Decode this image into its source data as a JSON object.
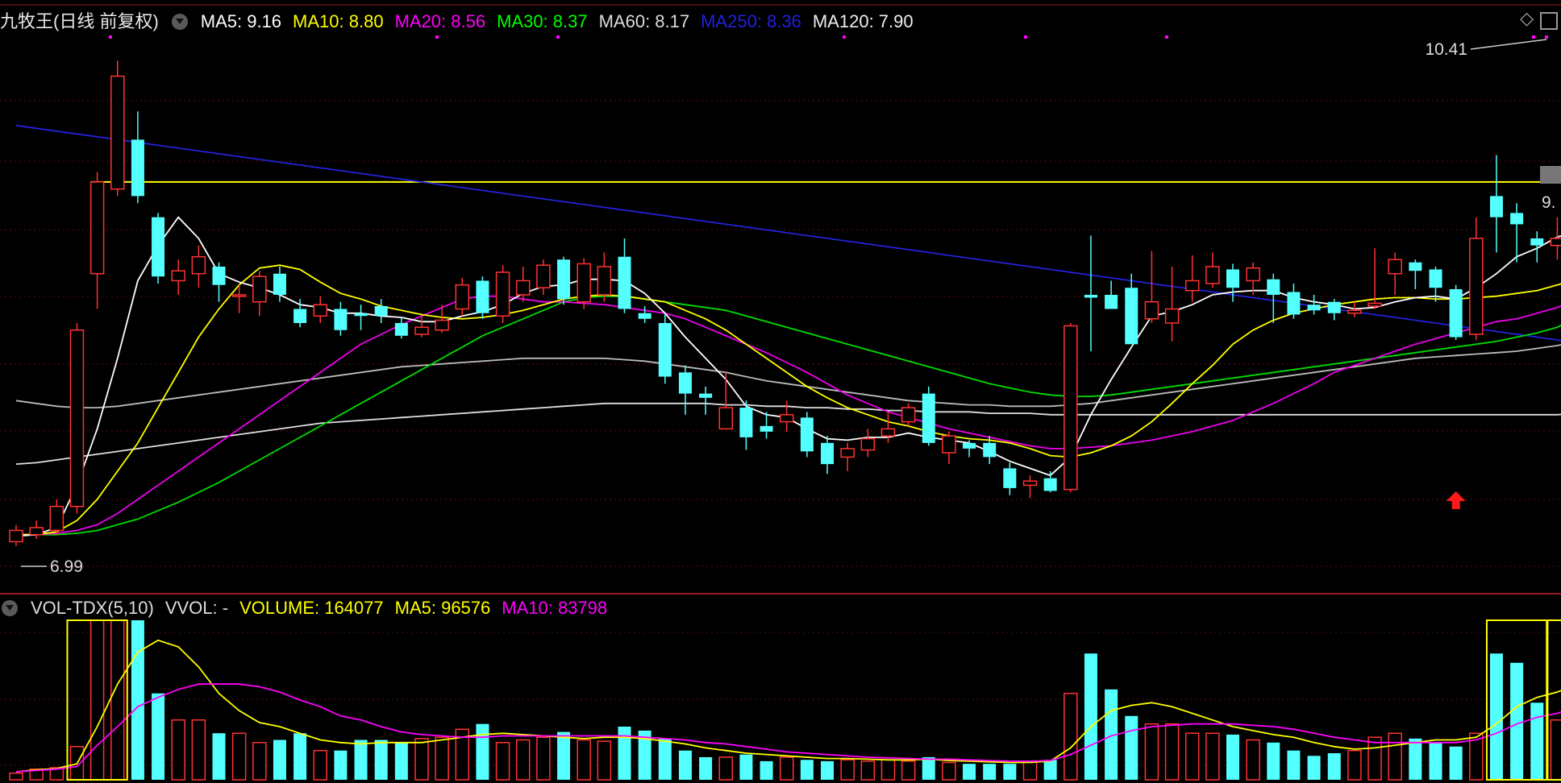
{
  "stock": {
    "name": "九牧王(日线 前复权)"
  },
  "ma_legend": [
    {
      "label": "MA5: 9.16",
      "color": "#ffffff"
    },
    {
      "label": "MA10: 8.80",
      "color": "#ffff00"
    },
    {
      "label": "MA20: 8.56",
      "color": "#ff00ff"
    },
    {
      "label": "MA30: 8.37",
      "color": "#00ff00"
    },
    {
      "label": "MA60: 8.17",
      "color": "#dddddd"
    },
    {
      "label": "MA250: 8.36",
      "color": "#2020e0"
    },
    {
      "label": "MA120: 7.90",
      "color": "#eeeeee"
    }
  ],
  "vol_legend": {
    "name": "VOL-TDX(5,10)",
    "vvol": "VVOL: -",
    "volume": "VOLUME: 164077",
    "ma5": "MA5: 96576",
    "ma10": "MA10: 83798"
  },
  "annotations": {
    "high": "10.41",
    "low": "6.99",
    "current_partial": "9."
  },
  "icons": {
    "diamond": "◇"
  },
  "colors": {
    "up": "#ff3232",
    "down": "#54ffff",
    "bg": "#000000",
    "grid": "#5a1010"
  },
  "chart_data": {
    "type": "candlestick",
    "ylim": [
      6.7,
      10.6
    ],
    "candles": [
      [
        7.0,
        7.08,
        7.12,
        6.97
      ],
      [
        7.05,
        7.1,
        7.15,
        7.02
      ],
      [
        7.08,
        7.25,
        7.3,
        7.05
      ],
      [
        7.25,
        8.5,
        8.55,
        7.2
      ],
      [
        8.9,
        9.55,
        9.62,
        8.65
      ],
      [
        9.5,
        10.3,
        10.41,
        9.45
      ],
      [
        9.85,
        9.45,
        10.05,
        9.4
      ],
      [
        9.3,
        8.88,
        9.33,
        8.83
      ],
      [
        8.85,
        8.92,
        9.0,
        8.75
      ],
      [
        8.9,
        9.02,
        9.1,
        8.8
      ],
      [
        8.95,
        8.82,
        8.98,
        8.7
      ],
      [
        8.74,
        8.75,
        8.82,
        8.62
      ],
      [
        8.7,
        8.88,
        8.92,
        8.6
      ],
      [
        8.9,
        8.75,
        8.95,
        8.7
      ],
      [
        8.65,
        8.55,
        8.72,
        8.52
      ],
      [
        8.6,
        8.68,
        8.74,
        8.55
      ],
      [
        8.65,
        8.5,
        8.7,
        8.46
      ],
      [
        8.62,
        8.6,
        8.68,
        8.5
      ],
      [
        8.67,
        8.6,
        8.72,
        8.55
      ],
      [
        8.55,
        8.46,
        8.59,
        8.44
      ],
      [
        8.47,
        8.52,
        8.6,
        8.45
      ],
      [
        8.5,
        8.57,
        8.68,
        8.48
      ],
      [
        8.65,
        8.82,
        8.87,
        8.6
      ],
      [
        8.85,
        8.62,
        8.88,
        8.58
      ],
      [
        8.6,
        8.91,
        8.96,
        8.55
      ],
      [
        8.75,
        8.85,
        8.95,
        8.7
      ],
      [
        8.8,
        8.96,
        9.0,
        8.75
      ],
      [
        9.0,
        8.72,
        9.02,
        8.68
      ],
      [
        8.7,
        8.97,
        9.01,
        8.65
      ],
      [
        8.75,
        8.95,
        9.05,
        8.7
      ],
      [
        9.02,
        8.65,
        9.15,
        8.62
      ],
      [
        8.62,
        8.58,
        8.67,
        8.55
      ],
      [
        8.55,
        8.17,
        8.62,
        8.12
      ],
      [
        8.2,
        8.05,
        8.25,
        7.9
      ],
      [
        8.05,
        8.02,
        8.1,
        7.9
      ],
      [
        7.8,
        7.95,
        8.2,
        7.95
      ],
      [
        7.95,
        7.74,
        8.0,
        7.65
      ],
      [
        7.82,
        7.78,
        7.92,
        7.73
      ],
      [
        7.85,
        7.9,
        8.0,
        7.78
      ],
      [
        7.88,
        7.64,
        7.92,
        7.6
      ],
      [
        7.7,
        7.55,
        7.75,
        7.48
      ],
      [
        7.6,
        7.66,
        7.7,
        7.5
      ],
      [
        7.65,
        7.73,
        7.8,
        7.6
      ],
      [
        7.75,
        7.8,
        7.92,
        7.7
      ],
      [
        7.85,
        7.95,
        7.98,
        7.82
      ],
      [
        8.05,
        7.7,
        8.1,
        7.68
      ],
      [
        7.63,
        7.75,
        7.78,
        7.55
      ],
      [
        7.7,
        7.66,
        7.72,
        7.6
      ],
      [
        7.7,
        7.6,
        7.75,
        7.55
      ],
      [
        7.52,
        7.38,
        7.56,
        7.33
      ],
      [
        7.4,
        7.43,
        7.47,
        7.31
      ],
      [
        7.45,
        7.36,
        7.5,
        7.35
      ],
      [
        7.37,
        8.53,
        8.55,
        7.35
      ],
      [
        8.75,
        8.73,
        9.17,
        8.35
      ],
      [
        8.75,
        8.65,
        8.85,
        8.7
      ],
      [
        8.8,
        8.4,
        8.9,
        8.4
      ],
      [
        8.58,
        8.7,
        9.06,
        8.55
      ],
      [
        8.55,
        8.65,
        8.95,
        8.42
      ],
      [
        8.78,
        8.85,
        9.03,
        8.7
      ],
      [
        8.83,
        8.95,
        9.05,
        8.8
      ],
      [
        8.93,
        8.8,
        8.97,
        8.7
      ],
      [
        8.85,
        8.94,
        8.98,
        8.75
      ],
      [
        8.86,
        8.75,
        8.9,
        8.55
      ],
      [
        8.77,
        8.61,
        8.83,
        8.58
      ],
      [
        8.68,
        8.64,
        8.75,
        8.61
      ],
      [
        8.7,
        8.62,
        8.72,
        8.57
      ],
      [
        8.62,
        8.64,
        8.7,
        8.59
      ],
      [
        8.67,
        8.69,
        9.08,
        8.65
      ],
      [
        8.9,
        9.0,
        9.05,
        8.75
      ],
      [
        8.98,
        8.92,
        9.0,
        8.79
      ],
      [
        8.93,
        8.8,
        8.95,
        8.7
      ],
      [
        8.79,
        8.45,
        8.82,
        8.43
      ],
      [
        8.47,
        9.15,
        9.3,
        8.43
      ],
      [
        9.45,
        9.3,
        9.74,
        9.05
      ],
      [
        9.33,
        9.25,
        9.4,
        8.98
      ],
      [
        9.15,
        9.1,
        9.2,
        8.98
      ],
      [
        9.1,
        9.15,
        9.3,
        9.0
      ],
      [
        9.2,
        9.45,
        9.78,
        9.18
      ],
      [
        9.45,
        10.1,
        10.41,
        9.4
      ]
    ],
    "volume_ylim": [
      0,
      120000
    ],
    "volume": [
      5000,
      8000,
      9000,
      25000,
      120000,
      165000,
      120000,
      65000,
      45000,
      45000,
      35000,
      35000,
      28000,
      30000,
      35000,
      22000,
      22000,
      30000,
      30000,
      28000,
      31000,
      32000,
      38000,
      42000,
      28000,
      30000,
      32000,
      36000,
      30000,
      29000,
      40000,
      37000,
      31000,
      22000,
      17000,
      17000,
      19000,
      14000,
      17000,
      15000,
      14000,
      15000,
      14000,
      15000,
      14000,
      17000,
      13000,
      12000,
      12000,
      12000,
      14000,
      15000,
      65000,
      95000,
      68000,
      48000,
      42000,
      42000,
      35000,
      35000,
      34000,
      30000,
      28000,
      22000,
      18000,
      20000,
      22000,
      32000,
      35000,
      31000,
      28000,
      25000,
      35000,
      95000,
      88000,
      58000,
      45000,
      42000,
      164077
    ],
    "vol_ma5": [
      6000,
      7500,
      8500,
      12000,
      40000,
      72000,
      96000,
      105000,
      100000,
      85000,
      65000,
      52000,
      43000,
      40000,
      35000,
      30000,
      28000,
      27000,
      28000,
      28000,
      28000,
      30000,
      32000,
      34000,
      35000,
      34000,
      33000,
      32000,
      31000,
      32000,
      32000,
      31000,
      29000,
      27000,
      24000,
      22000,
      20000,
      19000,
      18000,
      17000,
      16000,
      16000,
      15500,
      15000,
      15000,
      15500,
      14500,
      14000,
      13500,
      13000,
      13000,
      14000,
      24000,
      40000,
      52000,
      56000,
      58000,
      55000,
      50000,
      45000,
      40000,
      37000,
      34000,
      32000,
      28000,
      25000,
      23000,
      24000,
      26000,
      28000,
      30000,
      30000,
      32000,
      42000,
      55000,
      62000,
      66000,
      72000,
      96576
    ],
    "vol_ma10": [
      6000,
      7000,
      8000,
      10000,
      26000,
      40000,
      55000,
      62000,
      68000,
      72000,
      72000,
      72000,
      70000,
      66000,
      60000,
      55000,
      48000,
      45000,
      40000,
      36000,
      34000,
      33000,
      32000,
      32000,
      33000,
      33000,
      33000,
      33000,
      33000,
      33000,
      33000,
      32000,
      31000,
      30000,
      28000,
      27000,
      25000,
      23000,
      21000,
      20000,
      19000,
      18000,
      17000,
      16500,
      16000,
      15500,
      15500,
      15000,
      14500,
      14000,
      14000,
      14500,
      19000,
      26000,
      33000,
      37000,
      40000,
      41000,
      42000,
      42000,
      42000,
      41000,
      40000,
      38000,
      35000,
      32000,
      30000,
      28000,
      28000,
      28000,
      28000,
      28000,
      30000,
      35000,
      42000,
      47000,
      50000,
      55000,
      83798
    ],
    "ma5": [
      7.04,
      7.05,
      7.1,
      7.4,
      7.8,
      8.3,
      8.85,
      9.1,
      9.3,
      9.15,
      8.9,
      8.84,
      8.8,
      8.75,
      8.68,
      8.66,
      8.62,
      8.62,
      8.6,
      8.59,
      8.56,
      8.56,
      8.6,
      8.63,
      8.68,
      8.76,
      8.81,
      8.82,
      8.86,
      8.86,
      8.85,
      8.76,
      8.62,
      8.45,
      8.3,
      8.15,
      7.96,
      7.9,
      7.88,
      7.8,
      7.73,
      7.72,
      7.74,
      7.74,
      7.77,
      7.74,
      7.72,
      7.7,
      7.64,
      7.57,
      7.52,
      7.47,
      7.6,
      7.9,
      8.15,
      8.38,
      8.6,
      8.63,
      8.68,
      8.75,
      8.77,
      8.78,
      8.78,
      8.73,
      8.7,
      8.68,
      8.65,
      8.66,
      8.7,
      8.73,
      8.74,
      8.72,
      8.8,
      8.9,
      9.02,
      9.08,
      9.16,
      9.2,
      9.16
    ],
    "ma10": [
      7.05,
      7.05,
      7.07,
      7.15,
      7.3,
      7.5,
      7.7,
      7.95,
      8.2,
      8.45,
      8.65,
      8.82,
      8.94,
      8.96,
      8.93,
      8.84,
      8.76,
      8.72,
      8.67,
      8.64,
      8.61,
      8.59,
      8.58,
      8.59,
      8.61,
      8.64,
      8.68,
      8.72,
      8.74,
      8.75,
      8.74,
      8.72,
      8.7,
      8.64,
      8.58,
      8.5,
      8.4,
      8.3,
      8.2,
      8.1,
      8.02,
      7.95,
      7.9,
      7.85,
      7.82,
      7.78,
      7.75,
      7.73,
      7.72,
      7.7,
      7.66,
      7.61,
      7.6,
      7.63,
      7.68,
      7.75,
      7.85,
      7.98,
      8.12,
      8.25,
      8.4,
      8.5,
      8.57,
      8.62,
      8.65,
      8.68,
      8.7,
      8.72,
      8.73,
      8.73,
      8.72,
      8.72,
      8.73,
      8.74,
      8.76,
      8.78,
      8.82,
      8.86,
      8.92
    ],
    "ma20": [
      7.05,
      7.05,
      7.06,
      7.08,
      7.12,
      7.2,
      7.3,
      7.4,
      7.5,
      7.6,
      7.7,
      7.8,
      7.9,
      8.0,
      8.1,
      8.2,
      8.3,
      8.4,
      8.47,
      8.54,
      8.6,
      8.66,
      8.72,
      8.74,
      8.74,
      8.72,
      8.7,
      8.7,
      8.69,
      8.68,
      8.66,
      8.64,
      8.62,
      8.58,
      8.52,
      8.46,
      8.4,
      8.34,
      8.27,
      8.2,
      8.12,
      8.04,
      7.98,
      7.92,
      7.88,
      7.84,
      7.8,
      7.77,
      7.74,
      7.71,
      7.68,
      7.66,
      7.66,
      7.67,
      7.68,
      7.7,
      7.72,
      7.75,
      7.78,
      7.82,
      7.86,
      7.92,
      7.98,
      8.05,
      8.12,
      8.2,
      8.25,
      8.3,
      8.35,
      8.4,
      8.44,
      8.48,
      8.52,
      8.56,
      8.58,
      8.62,
      8.66,
      8.72,
      8.8
    ],
    "ma30": [
      7.05,
      7.05,
      7.05,
      7.06,
      7.08,
      7.12,
      7.16,
      7.22,
      7.28,
      7.35,
      7.42,
      7.5,
      7.58,
      7.66,
      7.74,
      7.82,
      7.9,
      7.98,
      8.06,
      8.14,
      8.22,
      8.3,
      8.38,
      8.46,
      8.52,
      8.58,
      8.64,
      8.7,
      8.73,
      8.74,
      8.74,
      8.72,
      8.7,
      8.68,
      8.66,
      8.64,
      8.6,
      8.56,
      8.52,
      8.48,
      8.44,
      8.4,
      8.36,
      8.32,
      8.28,
      8.24,
      8.2,
      8.16,
      8.12,
      8.09,
      8.06,
      8.04,
      8.03,
      8.03,
      8.04,
      8.06,
      8.08,
      8.1,
      8.12,
      8.14,
      8.16,
      8.18,
      8.2,
      8.22,
      8.24,
      8.26,
      8.28,
      8.3,
      8.32,
      8.34,
      8.36,
      8.38,
      8.4,
      8.42,
      8.45,
      8.48,
      8.52,
      8.6,
      8.75
    ],
    "ma60": [
      8.0,
      7.98,
      7.96,
      7.95,
      7.95,
      7.96,
      7.98,
      8.0,
      8.02,
      8.04,
      8.06,
      8.08,
      8.1,
      8.12,
      8.14,
      8.16,
      8.18,
      8.2,
      8.22,
      8.24,
      8.25,
      8.26,
      8.27,
      8.28,
      8.29,
      8.3,
      8.3,
      8.3,
      8.3,
      8.3,
      8.29,
      8.28,
      8.26,
      8.24,
      8.22,
      8.2,
      8.17,
      8.14,
      8.12,
      8.1,
      8.08,
      8.06,
      8.04,
      8.02,
      8.0,
      7.99,
      7.98,
      7.97,
      7.97,
      7.96,
      7.96,
      7.96,
      7.97,
      7.98,
      8.0,
      8.02,
      8.04,
      8.06,
      8.08,
      8.1,
      8.12,
      8.14,
      8.16,
      8.18,
      8.2,
      8.22,
      8.24,
      8.26,
      8.28,
      8.3,
      8.31,
      8.32,
      8.33,
      8.34,
      8.35,
      8.37,
      8.39,
      8.42,
      8.5
    ],
    "ma120": [
      7.55,
      7.56,
      7.58,
      7.6,
      7.62,
      7.64,
      7.66,
      7.68,
      7.7,
      7.72,
      7.74,
      7.76,
      7.78,
      7.8,
      7.82,
      7.84,
      7.85,
      7.86,
      7.87,
      7.88,
      7.89,
      7.9,
      7.91,
      7.92,
      7.93,
      7.94,
      7.95,
      7.96,
      7.97,
      7.98,
      7.98,
      7.98,
      7.98,
      7.98,
      7.98,
      7.97,
      7.97,
      7.96,
      7.96,
      7.95,
      7.95,
      7.94,
      7.94,
      7.93,
      7.93,
      7.92,
      7.92,
      7.92,
      7.91,
      7.91,
      7.91,
      7.9,
      7.9,
      7.9,
      7.9,
      7.9,
      7.9,
      7.9,
      7.9,
      7.9,
      7.9,
      7.9,
      7.9,
      7.9,
      7.9,
      7.9,
      7.9,
      7.9,
      7.9,
      7.9,
      7.9,
      7.9,
      7.9,
      7.9,
      7.9,
      7.9,
      7.9,
      7.91,
      7.93
    ],
    "ma250": [
      9.95,
      9.93,
      9.91,
      9.89,
      9.87,
      9.85,
      9.83,
      9.81,
      9.79,
      9.77,
      9.75,
      9.73,
      9.71,
      9.69,
      9.67,
      9.65,
      9.63,
      9.61,
      9.59,
      9.57,
      9.55,
      9.53,
      9.51,
      9.49,
      9.47,
      9.45,
      9.43,
      9.41,
      9.39,
      9.37,
      9.35,
      9.33,
      9.31,
      9.29,
      9.27,
      9.25,
      9.23,
      9.21,
      9.19,
      9.17,
      9.15,
      9.13,
      9.11,
      9.09,
      9.07,
      9.05,
      9.03,
      9.01,
      8.99,
      8.97,
      8.95,
      8.93,
      8.91,
      8.89,
      8.87,
      8.85,
      8.83,
      8.81,
      8.79,
      8.77,
      8.75,
      8.73,
      8.71,
      8.69,
      8.67,
      8.65,
      8.63,
      8.61,
      8.59,
      8.57,
      8.55,
      8.53,
      8.51,
      8.49,
      8.47,
      8.45,
      8.43,
      8.4,
      8.36
    ],
    "resistance_line": 9.55,
    "signal_arrows": [
      71,
      77
    ]
  }
}
